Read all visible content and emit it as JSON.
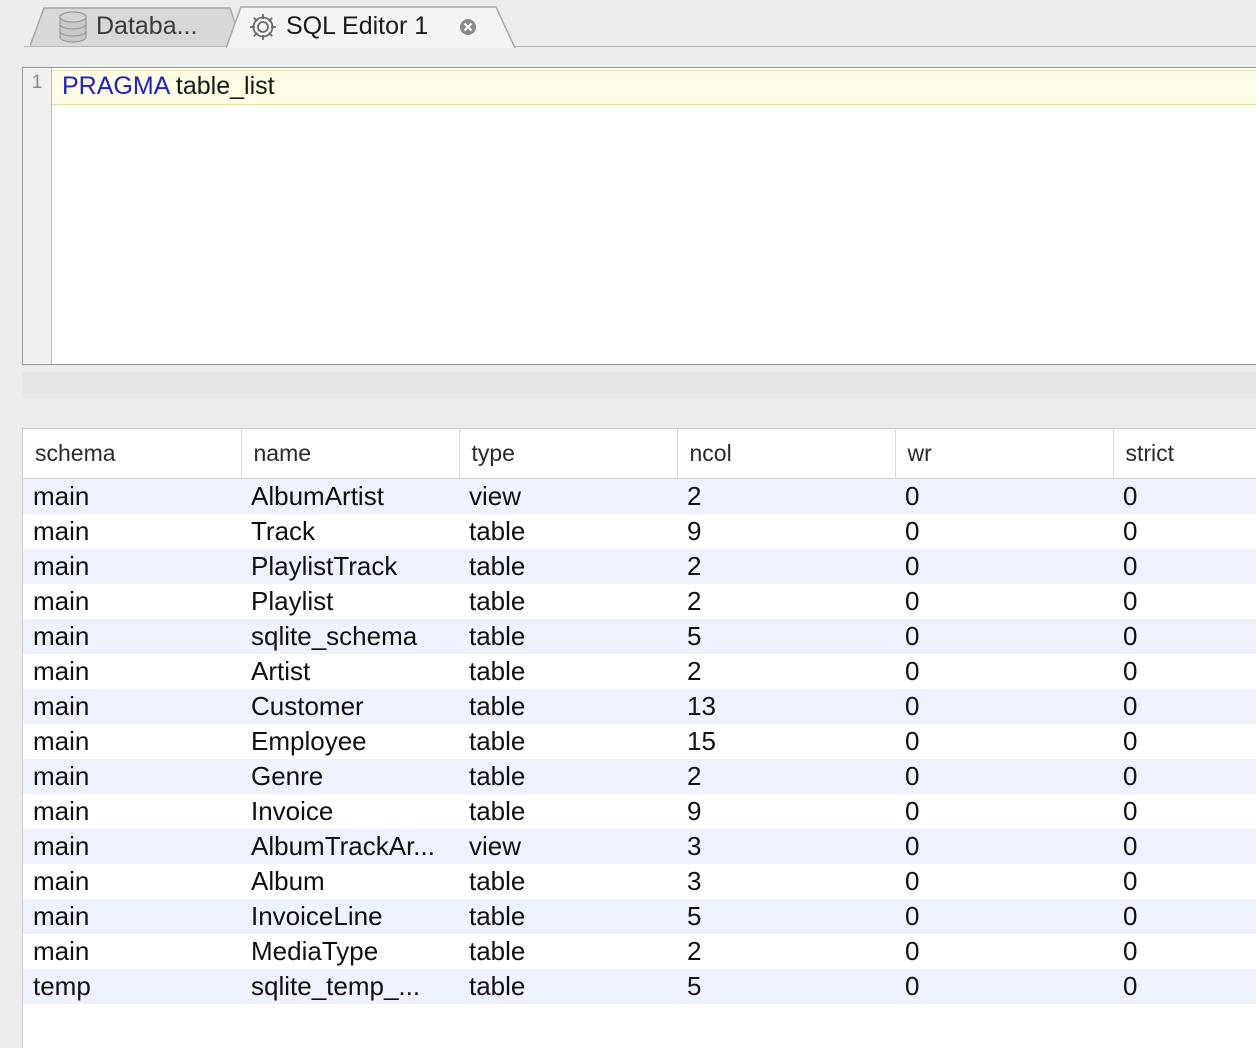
{
  "tabs": [
    {
      "label": "Databa...",
      "icon": "database-icon"
    },
    {
      "label": "SQL Editor 1",
      "icon": "gear-icon",
      "closable": true
    }
  ],
  "editor": {
    "line_number": "1",
    "keyword": "PRAGMA",
    "rest": " table_list"
  },
  "results": {
    "columns": [
      "schema",
      "name",
      "type",
      "ncol",
      "wr",
      "strict"
    ],
    "rows": [
      [
        "main",
        "AlbumArtist",
        "view",
        "2",
        "0",
        "0"
      ],
      [
        "main",
        "Track",
        "table",
        "9",
        "0",
        "0"
      ],
      [
        "main",
        "PlaylistTrack",
        "table",
        "2",
        "0",
        "0"
      ],
      [
        "main",
        "Playlist",
        "table",
        "2",
        "0",
        "0"
      ],
      [
        "main",
        "sqlite_schema",
        "table",
        "5",
        "0",
        "0"
      ],
      [
        "main",
        "Artist",
        "table",
        "2",
        "0",
        "0"
      ],
      [
        "main",
        "Customer",
        "table",
        "13",
        "0",
        "0"
      ],
      [
        "main",
        "Employee",
        "table",
        "15",
        "0",
        "0"
      ],
      [
        "main",
        "Genre",
        "table",
        "2",
        "0",
        "0"
      ],
      [
        "main",
        "Invoice",
        "table",
        "9",
        "0",
        "0"
      ],
      [
        "main",
        "AlbumTrackAr...",
        "view",
        "3",
        "0",
        "0"
      ],
      [
        "main",
        "Album",
        "table",
        "3",
        "0",
        "0"
      ],
      [
        "main",
        "InvoiceLine",
        "table",
        "5",
        "0",
        "0"
      ],
      [
        "main",
        "MediaType",
        "table",
        "2",
        "0",
        "0"
      ],
      [
        "temp",
        "sqlite_temp_...",
        "table",
        "5",
        "0",
        "0"
      ]
    ]
  }
}
